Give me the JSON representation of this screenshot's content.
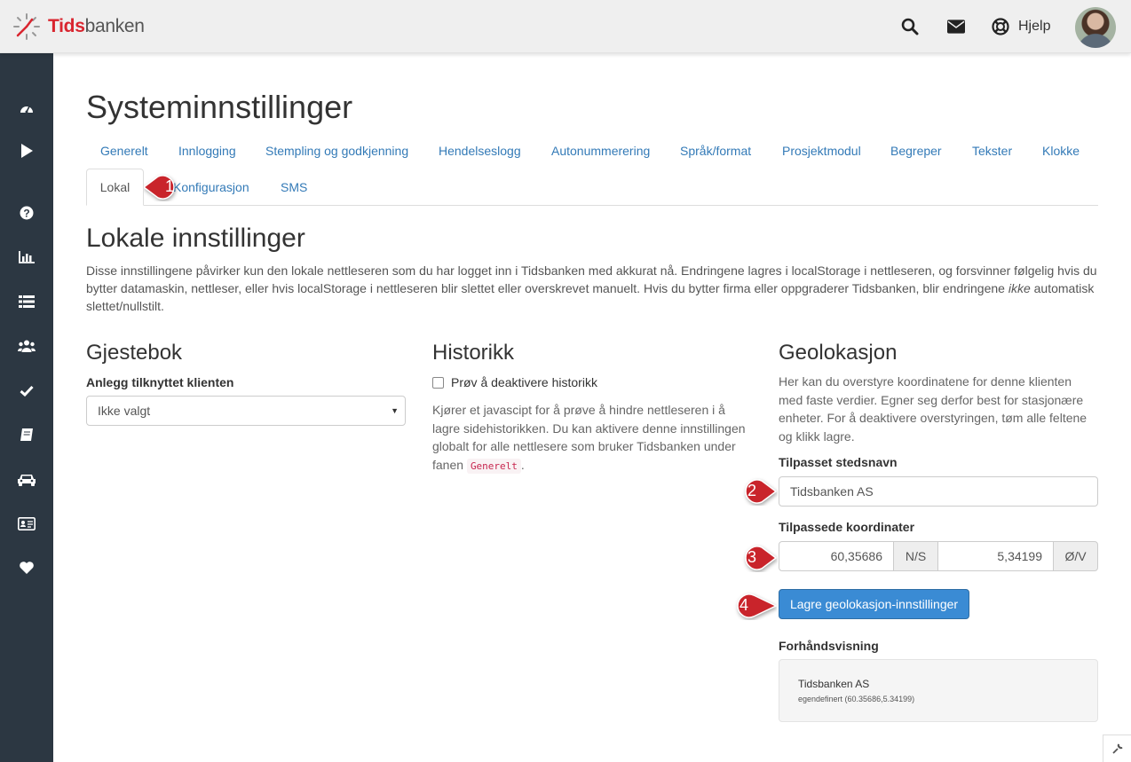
{
  "logo": {
    "brand_red": "Tids",
    "brand_gray": "banken"
  },
  "header": {
    "help_label": "Hjelp"
  },
  "page": {
    "title": "Systeminnstillinger"
  },
  "tabs": [
    {
      "label": "Generelt"
    },
    {
      "label": "Innlogging"
    },
    {
      "label": "Stempling og godkjenning"
    },
    {
      "label": "Hendelseslogg"
    },
    {
      "label": "Autonummerering"
    },
    {
      "label": "Språk/format"
    },
    {
      "label": "Prosjektmodul"
    },
    {
      "label": "Begreper"
    },
    {
      "label": "Tekster"
    },
    {
      "label": "Klokke"
    },
    {
      "label": "Lokal"
    },
    {
      "label": "Konfigurasjon"
    },
    {
      "label": "SMS"
    }
  ],
  "section": {
    "title": "Lokale innstillinger",
    "desc_before": "Disse innstillingene påvirker kun den lokale nettleseren som du har logget inn i Tidsbanken med akkurat nå. Endringene lagres i localStorage i nettleseren, og forsvinner følgelig hvis du bytter datamaskin, nettleser, eller hvis localStorage i nettleseren blir slettet eller overskrevet manuelt. Hvis du bytter firma eller oppgraderer Tidsbanken, blir endringene ",
    "desc_em": "ikke",
    "desc_after": " automatisk slettet/nullstilt."
  },
  "guestbook": {
    "title": "Gjestebok",
    "label": "Anlegg tilknyttet klienten",
    "selected": "Ikke valgt"
  },
  "history": {
    "title": "Historikk",
    "checkbox_label": "Prøv å deaktivere historikk",
    "desc": "Kjører et javascipt for å prøve å hindre nettleseren i å lagre sidehistorikken. Du kan aktivere denne innstillingen globalt for alle nettlesere som bruker Tidsbanken under fanen",
    "code": "Generelt",
    "desc_end": "."
  },
  "geo": {
    "title": "Geolokasjon",
    "desc": "Her kan du overstyre koordinatene for denne klienten med faste verdier. Egner seg derfor best for stasjonære enheter. For å deaktivere overstyringen, tøm alle feltene og klikk lagre.",
    "place_label": "Tilpasset stedsnavn",
    "place_value": "Tidsbanken AS",
    "coords_label": "Tilpassede koordinater",
    "lat_value": "60,35686",
    "lat_addon": "N/S",
    "lon_value": "5,34199",
    "lon_addon": "Ø/V",
    "save_label": "Lagre geolokasjon-innstillinger",
    "preview_label": "Forhåndsvisning",
    "preview_name": "Tidsbanken AS",
    "preview_sub": "egendefinert (60.35686,5.34199)"
  },
  "callouts": [
    "1",
    "2",
    "3",
    "4"
  ],
  "colors": {
    "sidebar": "#2c3742",
    "link": "#337ab7",
    "primary": "#3a8bd4",
    "callout": "#c9242b",
    "brand": "#d9252f"
  }
}
